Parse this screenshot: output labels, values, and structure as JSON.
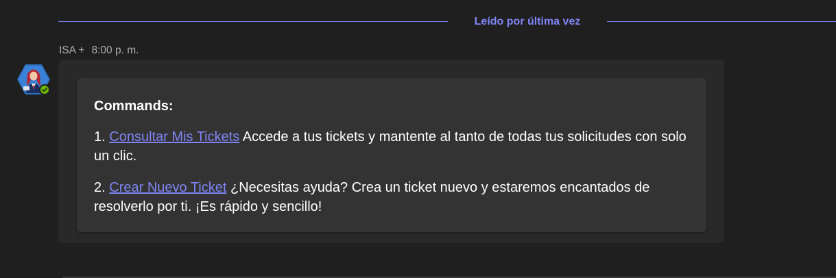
{
  "read_marker": {
    "label": "Leído por última vez"
  },
  "message": {
    "sender": "ISA +",
    "time": "8:00 p. m.",
    "presence": "available",
    "card": {
      "title": "Commands:",
      "items": [
        {
          "number": "1.",
          "link_label": "Consultar Mis Tickets",
          "description": " Accede a tus tickets y mantente al tanto de todas tus solicitudes con solo un clic."
        },
        {
          "number": "2.",
          "link_label": "Crear Nuevo Ticket",
          "description": " ¿Necesitas ayuda? Crea un ticket nuevo y estaremos encantados de resolverlo por ti. ¡Es rápido y sencillo!"
        }
      ]
    }
  },
  "colors": {
    "background": "#1f1f1f",
    "accent": "#7f85f5",
    "bubble": "#292929",
    "card": "#333333",
    "presence_available": "#6bb700",
    "avatar_hexagon": "#2f6fc0"
  },
  "icons": {
    "avatar": "bot-avatar-icon",
    "presence": "presence-available-icon"
  }
}
